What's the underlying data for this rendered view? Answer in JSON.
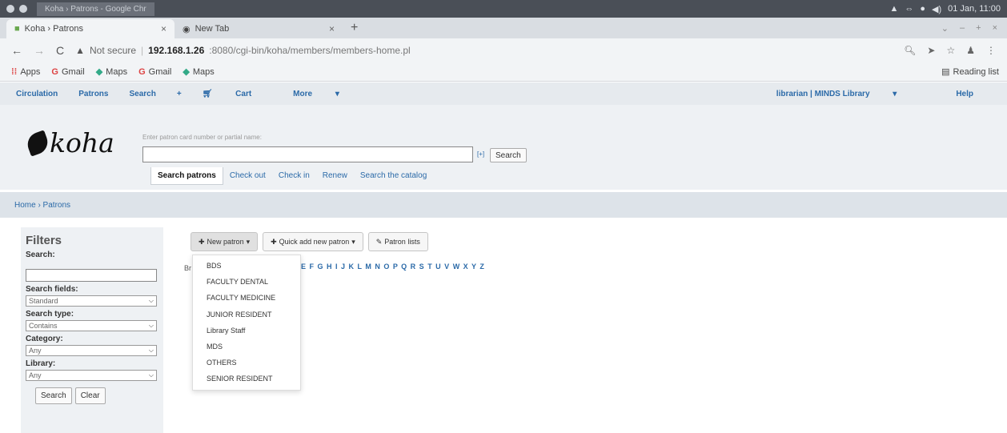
{
  "os": {
    "window_title": "Koha › Patrons - Google Chr",
    "clock": "01 Jan, 11:00"
  },
  "tabs": [
    {
      "label": "Koha › Patrons",
      "close": "×"
    },
    {
      "label": "New Tab",
      "close": "×"
    }
  ],
  "address": {
    "security": "Not secure",
    "host": "192.168.1.26",
    "path": ":8080/cgi-bin/koha/members/members-home.pl"
  },
  "bookmarks": [
    "Apps",
    "Gmail",
    "Maps",
    "Gmail",
    "Maps"
  ],
  "reading_list": "Reading list",
  "koha_nav": {
    "items": [
      "Circulation",
      "Patrons",
      "Search",
      "+",
      "Cart",
      "More"
    ],
    "user": "librarian | MINDS Library",
    "help": "Help"
  },
  "logo": "koha",
  "search": {
    "hint": "Enter patron card number or partial name:",
    "plus": "[+]",
    "button": "Search",
    "tabs": [
      "Search patrons",
      "Check out",
      "Check in",
      "Renew",
      "Search the catalog"
    ]
  },
  "breadcrumb": "Home › Patrons",
  "filters": {
    "title": "Filters",
    "search_label": "Search:",
    "search_fields_label": "Search fields:",
    "search_fields_value": "Standard",
    "search_type_label": "Search type:",
    "search_type_value": "Contains",
    "category_label": "Category:",
    "category_value": "Any",
    "library_label": "Library:",
    "library_value": "Any",
    "search_button": "Search",
    "clear_button": "Clear"
  },
  "toolbar": {
    "new_patron": "New patron",
    "quick_add": "Quick add new patron",
    "patron_lists": "Patron lists"
  },
  "alpha_prefix": "Br",
  "alpha_letters": "E F G H I J K L M N O P Q R S T U V W X Y Z",
  "categories": [
    "BDS",
    "FACULTY DENTAL",
    "FACULTY MEDICINE",
    "JUNIOR RESIDENT",
    "Library Staff",
    "MDS",
    "OTHERS",
    "SENIOR RESIDENT"
  ]
}
